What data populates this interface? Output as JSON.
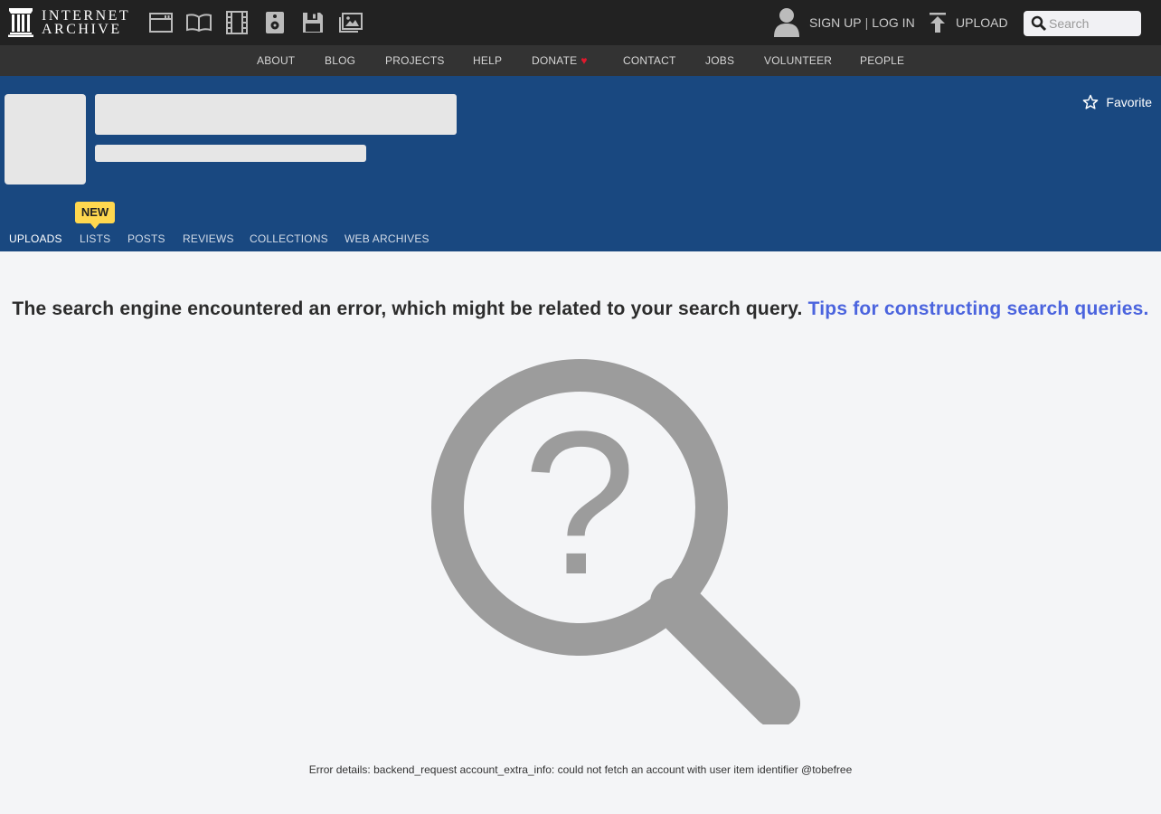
{
  "topbar": {
    "logo": {
      "line1": "INTERNET",
      "line2": "ARCHIVE"
    },
    "media_icons": [
      "web-icon",
      "texts-icon",
      "video-icon",
      "audio-icon",
      "software-icon",
      "images-icon"
    ],
    "sign_up": "SIGN UP",
    "separator": "|",
    "log_in": "LOG IN",
    "upload": "UPLOAD",
    "search_placeholder": "Search"
  },
  "nav": {
    "items": [
      "ABOUT",
      "BLOG",
      "PROJECTS",
      "HELP",
      "DONATE",
      "CONTACT",
      "JOBS",
      "VOLUNTEER",
      "PEOPLE"
    ]
  },
  "account": {
    "favorite": "Favorite",
    "new_badge": "NEW",
    "tabs": [
      "UPLOADS",
      "LISTS",
      "POSTS",
      "REVIEWS",
      "COLLECTIONS",
      "WEB ARCHIVES"
    ],
    "active_tab": "UPLOADS"
  },
  "main": {
    "error_text": "The search engine encountered an error, which might be related to your search query.",
    "tips_link": "Tips for constructing search queries.",
    "error_details": "Error details: backend_request account_extra_info: could not fetch an account with user item identifier @tobefree"
  },
  "colors": {
    "topbar": "#222222",
    "navbar": "#333333",
    "header": "#194880",
    "link": "#4b64de",
    "badge": "#ffd84f",
    "heart": "#e0192d"
  }
}
